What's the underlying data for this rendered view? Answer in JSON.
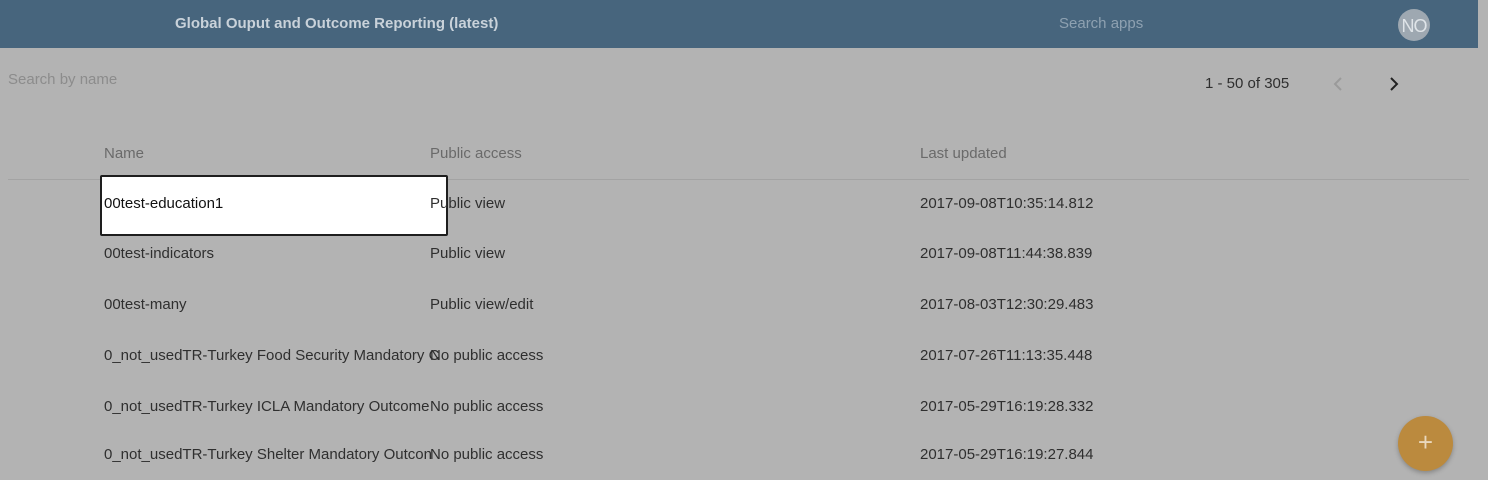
{
  "header": {
    "app_title": "Global Ouput and Outcome Reporting (latest)",
    "search_placeholder": "Search apps",
    "avatar_initials": "NO"
  },
  "toolbar": {
    "search_placeholder": "Search by name",
    "pagination": "1 - 50 of 305",
    "prev_icon": "chevron-left-icon",
    "next_icon": "chevron-right-icon"
  },
  "table": {
    "columns": [
      "Name",
      "Public access",
      "Last updated"
    ],
    "rows": [
      {
        "name": "00test-education1",
        "access": "Public view",
        "updated": "2017-09-08T10:35:14.812"
      },
      {
        "name": "00test-indicators",
        "access": "Public view",
        "updated": "2017-09-08T11:44:38.839"
      },
      {
        "name": "00test-many",
        "access": "Public view/edit",
        "updated": "2017-08-03T12:30:29.483"
      },
      {
        "name": "0_not_usedTR-Turkey Food Security Mandatory C",
        "access": "No public access",
        "updated": "2017-07-26T11:13:35.448"
      },
      {
        "name": "0_not_usedTR-Turkey ICLA Mandatory Outcome",
        "access": "No public access",
        "updated": "2017-05-29T16:19:28.332"
      },
      {
        "name": "0_not_usedTR-Turkey Shelter Mandatory Outcon",
        "access": "No public access",
        "updated": "2017-05-29T16:19:27.844"
      }
    ]
  },
  "fab": {
    "icon": "plus-icon",
    "label": "+"
  },
  "colors": {
    "header_bg": "#47657d",
    "overlay_bg": "#b3b3b3",
    "fab_bg": "#bb8a3e"
  }
}
